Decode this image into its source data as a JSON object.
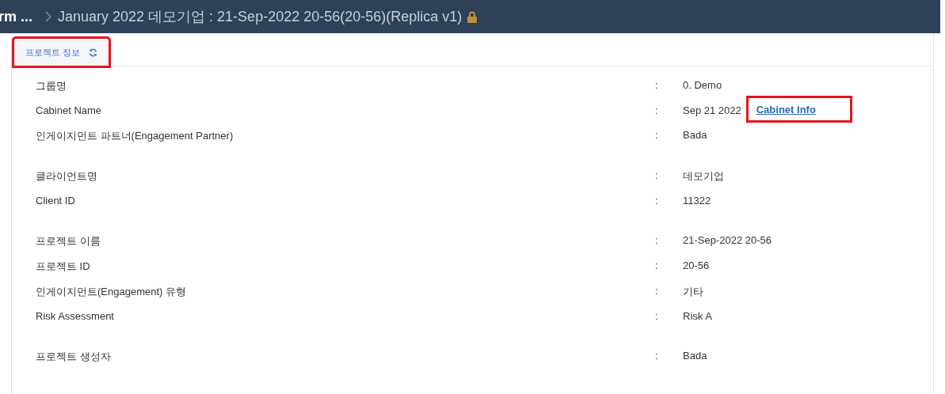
{
  "header": {
    "breadcrumb_prev": "rm ...",
    "title": "January 2022 데모기업 : 21-Sep-2022 20-56(20-56)(Replica v1)",
    "locked": true
  },
  "tabs": [
    {
      "label": "프로젝트 정보",
      "selected": true,
      "highlighted": true
    }
  ],
  "groups": [
    {
      "rows": [
        {
          "label": "그룹명",
          "separator": ":",
          "value": "0. Demo"
        },
        {
          "label": "Cabinet Name",
          "separator": ":",
          "value": "Sep 21 2022",
          "link": {
            "label": "Cabinet Info",
            "highlighted": true
          }
        },
        {
          "label": "인게이지먼트 파트너(Engagement Partner)",
          "separator": ":",
          "value": "Bada"
        }
      ]
    },
    {
      "rows": [
        {
          "label": "클라이언트명",
          "separator": ":",
          "value": "데모기업"
        },
        {
          "label": "Client ID",
          "separator": ":",
          "value": "11322"
        }
      ]
    },
    {
      "rows": [
        {
          "label": "프로젝트 이름",
          "separator": ":",
          "value": "21-Sep-2022 20-56"
        },
        {
          "label": "프로젝트 ID",
          "separator": ":",
          "value": "20-56"
        },
        {
          "label": "인게이지먼트(Engagement) 유형",
          "separator": ":",
          "value": "기타"
        },
        {
          "label": "Risk Assessment",
          "separator": ":",
          "value": "Risk A"
        }
      ]
    },
    {
      "rows": [
        {
          "label": "프로젝트 생성자",
          "separator": ":",
          "value": "Bada"
        }
      ]
    }
  ]
}
